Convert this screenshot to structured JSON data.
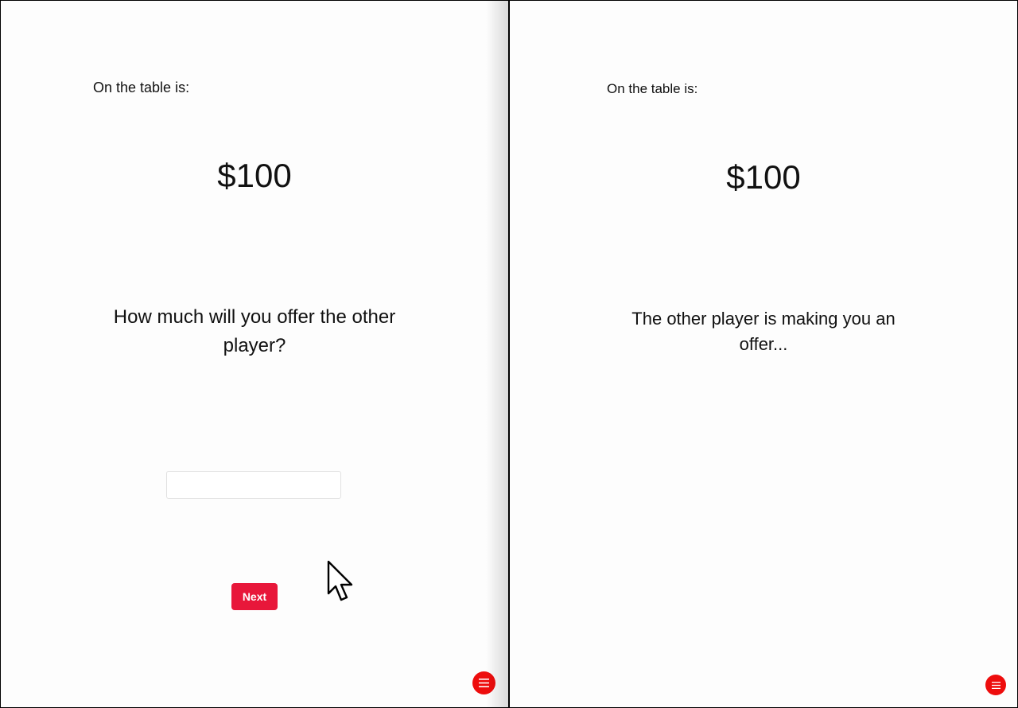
{
  "left_panel": {
    "table_label": "On the table is:",
    "amount": "$100",
    "prompt": "How much will you offer the other player?",
    "offer_input": {
      "value": "",
      "placeholder": ""
    },
    "next_label": "Next",
    "menu_icon": "menu-icon"
  },
  "right_panel": {
    "table_label": "On the table is:",
    "amount": "$100",
    "status": "The other player is making you an offer...",
    "menu_icon": "menu-icon"
  },
  "colors": {
    "accent": "#e8173a",
    "menu_button": "#ee0d0d"
  }
}
